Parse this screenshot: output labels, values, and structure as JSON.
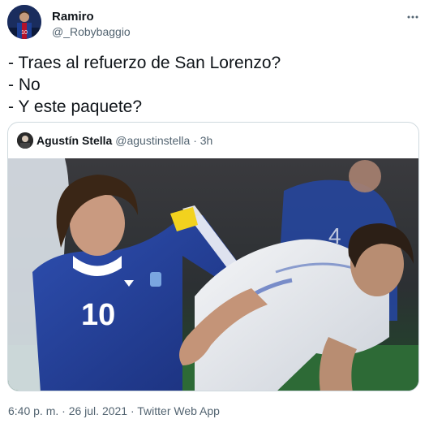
{
  "tweet": {
    "author_name": "Ramiro",
    "author_handle": "@_Robybaggio",
    "text": "- Traes al refuerzo de San Lorenzo?\n- No\n- Y este paquete?",
    "timestamp": "6:40 p. m. · 26 jul. 2021 · Twitter Web App"
  },
  "quoted": {
    "author_name": "Agustín Stella",
    "author_handle": "@agustinstella",
    "time_ago": "· 3h",
    "photo": {
      "player_left_number": "10"
    }
  },
  "icons": {
    "more": "more-options-icon"
  },
  "colors": {
    "text_primary": "#0f1419",
    "text_secondary": "#536471",
    "border": "#cfd9de"
  }
}
